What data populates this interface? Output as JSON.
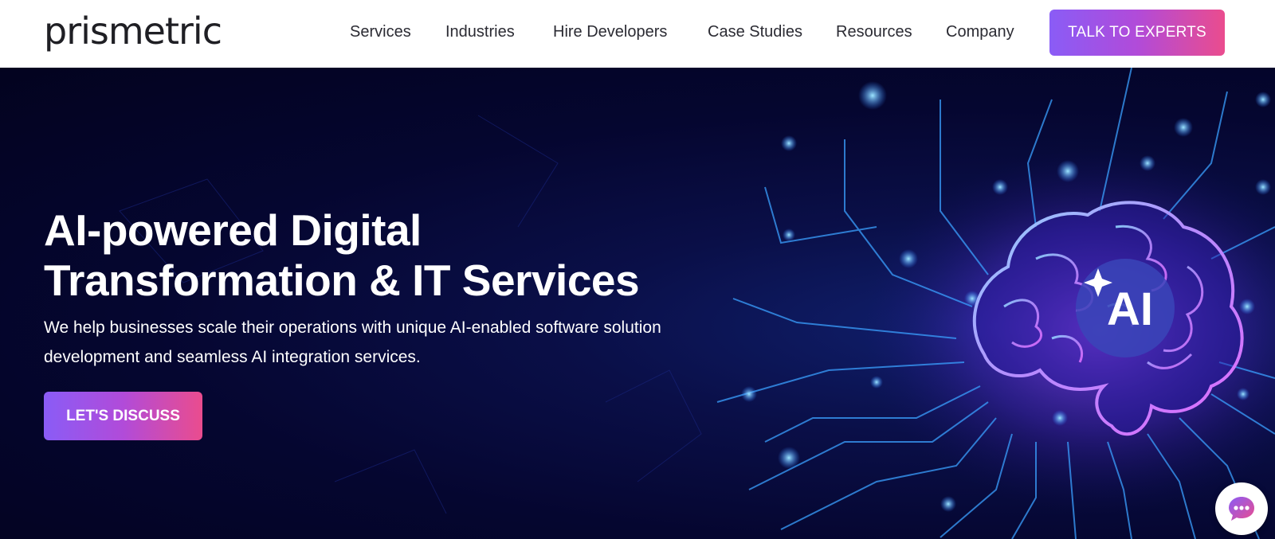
{
  "brand": {
    "name": "prismetric"
  },
  "nav": {
    "items": [
      {
        "label": "Services"
      },
      {
        "label": "Industries"
      },
      {
        "label": "Hire Developers"
      },
      {
        "label": "Case Studies"
      },
      {
        "label": "Resources"
      },
      {
        "label": "Company"
      }
    ],
    "cta_label": "TALK TO EXPERTS"
  },
  "hero": {
    "title_line1": "AI-powered Digital",
    "title_line2": "Transformation & IT Services",
    "subtitle_line1": "We help businesses scale their operations with unique AI-enabled software solution",
    "subtitle_line2": "development and seamless AI integration services.",
    "cta_label": "LET'S DISCUSS",
    "badge_text": "AI"
  },
  "chat": {
    "icon": "chat-bubble-icon"
  },
  "colors": {
    "gradient_start": "#8a5cf6",
    "gradient_end": "#ea4c8e",
    "hero_bg": "#050630",
    "circuit": "#3aa0ff"
  }
}
